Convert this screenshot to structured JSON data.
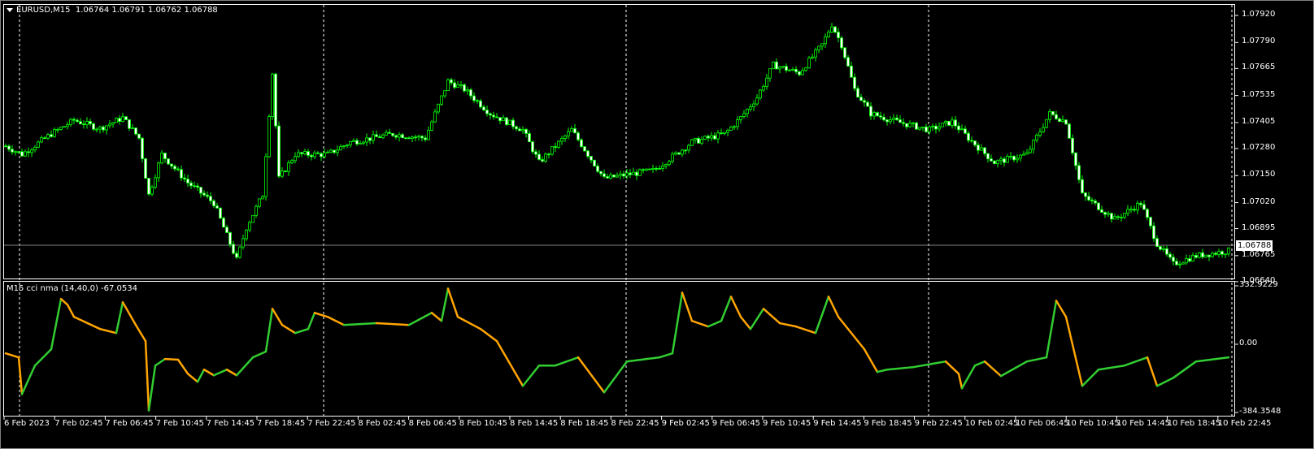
{
  "header": {
    "symbol": "EURUSD,M15",
    "ohlc": "1.06764 1.06791 1.06762 1.06788"
  },
  "indicator": {
    "title": "M15 cci nma (14,40,0) -67.0534"
  },
  "current_price": "1.06788",
  "colors": {
    "bull": "#00ff00",
    "bear_body": "#ffffff",
    "cci_up": "#32cd32",
    "cci_down": "#ffa500",
    "grid": "#ffffff",
    "price_line": "#808080"
  },
  "chart_data": [
    {
      "type": "candlestick",
      "title": "EURUSD,M15",
      "bars": 377,
      "y_ticks": [
        "1.07920",
        "1.07790",
        "1.07665",
        "1.07535",
        "1.07405",
        "1.07280",
        "1.07150",
        "1.07020",
        "1.06895",
        "1.06765",
        "1.06640"
      ],
      "ylim": [
        1.0664,
        1.0792
      ],
      "close_path": [
        [
          0,
          1.07292
        ],
        [
          5,
          1.07252
        ],
        [
          14,
          1.0735
        ],
        [
          21,
          1.07416
        ],
        [
          29,
          1.07377
        ],
        [
          36,
          1.07428
        ],
        [
          41,
          1.0733
        ],
        [
          44,
          1.07057
        ],
        [
          48,
          1.07252
        ],
        [
          56,
          1.07116
        ],
        [
          64,
          1.07018
        ],
        [
          71,
          1.06745
        ],
        [
          74,
          1.06901
        ],
        [
          79,
          1.07057
        ],
        [
          82,
          1.07643
        ],
        [
          84,
          1.07135
        ],
        [
          89,
          1.07252
        ],
        [
          99,
          1.07252
        ],
        [
          106,
          1.07311
        ],
        [
          119,
          1.0735
        ],
        [
          129,
          1.0733
        ],
        [
          136,
          1.07604
        ],
        [
          141,
          1.07565
        ],
        [
          149,
          1.07448
        ],
        [
          159,
          1.0737
        ],
        [
          164,
          1.07213
        ],
        [
          174,
          1.0737
        ],
        [
          184,
          1.07135
        ],
        [
          191,
          1.07155
        ],
        [
          199,
          1.07174
        ],
        [
          206,
          1.07252
        ],
        [
          211,
          1.07311
        ],
        [
          221,
          1.0735
        ],
        [
          226,
          1.07428
        ],
        [
          231,
          1.07526
        ],
        [
          236,
          1.07682
        ],
        [
          244,
          1.07643
        ],
        [
          251,
          1.07779
        ],
        [
          254,
          1.07877
        ],
        [
          257,
          1.07779
        ],
        [
          261,
          1.07565
        ],
        [
          266,
          1.07448
        ],
        [
          274,
          1.07409
        ],
        [
          284,
          1.0737
        ],
        [
          291,
          1.07409
        ],
        [
          296,
          1.0733
        ],
        [
          304,
          1.07213
        ],
        [
          314,
          1.07252
        ],
        [
          321,
          1.07448
        ],
        [
          326,
          1.07409
        ],
        [
          331,
          1.07057
        ],
        [
          341,
          1.0694
        ],
        [
          349,
          1.07018
        ],
        [
          354,
          1.06823
        ],
        [
          359,
          1.06725
        ],
        [
          366,
          1.06764
        ],
        [
          376,
          1.06788
        ]
      ],
      "x_ticks": [
        "6 Feb 2023",
        "7 Feb 02:45",
        "7 Feb 06:45",
        "7 Feb 10:45",
        "7 Feb 14:45",
        "7 Feb 18:45",
        "7 Feb 22:45",
        "8 Feb 02:45",
        "8 Feb 06:45",
        "8 Feb 10:45",
        "8 Feb 14:45",
        "8 Feb 18:45",
        "8 Feb 22:45",
        "9 Feb 02:45",
        "9 Feb 06:45",
        "9 Feb 10:45",
        "9 Feb 14:45",
        "9 Feb 18:45",
        "9 Feb 22:45",
        "10 Feb 02:45",
        "10 Feb 06:45",
        "10 Feb 10:45",
        "10 Feb 14:45",
        "10 Feb 18:45",
        "10 Feb 22:45"
      ]
    },
    {
      "type": "line",
      "title": "M15 cci nma (14,40,0)",
      "y_ticks": [
        "332.9229",
        "0.00",
        "-384.3548"
      ],
      "ylim": [
        -384.3548,
        332.9229
      ],
      "points": [
        [
          0,
          -51
        ],
        [
          4,
          -74
        ],
        [
          5,
          -281
        ],
        [
          9,
          -120
        ],
        [
          14,
          -28
        ],
        [
          17,
          258
        ],
        [
          19,
          225
        ],
        [
          21,
          156
        ],
        [
          29,
          87
        ],
        [
          34,
          64
        ],
        [
          36,
          239
        ],
        [
          40,
          110
        ],
        [
          43,
          18
        ],
        [
          44,
          -373
        ],
        [
          46,
          -120
        ],
        [
          49,
          -83
        ],
        [
          53,
          -87
        ],
        [
          56,
          -166
        ],
        [
          59,
          -212
        ],
        [
          61,
          -143
        ],
        [
          64,
          -175
        ],
        [
          68,
          -143
        ],
        [
          71,
          -175
        ],
        [
          76,
          -74
        ],
        [
          80,
          -41
        ],
        [
          82,
          202
        ],
        [
          85,
          110
        ],
        [
          89,
          64
        ],
        [
          93,
          87
        ],
        [
          95,
          179
        ],
        [
          99,
          156
        ],
        [
          104,
          110
        ],
        [
          114,
          120
        ],
        [
          124,
          110
        ],
        [
          131,
          179
        ],
        [
          134,
          133
        ],
        [
          136,
          317
        ],
        [
          139,
          156
        ],
        [
          146,
          87
        ],
        [
          151,
          18
        ],
        [
          159,
          -235
        ],
        [
          164,
          -120
        ],
        [
          169,
          -120
        ],
        [
          176,
          -74
        ],
        [
          184,
          -271
        ],
        [
          191,
          -97
        ],
        [
          201,
          -74
        ],
        [
          205,
          -51
        ],
        [
          208,
          294
        ],
        [
          211,
          133
        ],
        [
          216,
          101
        ],
        [
          220,
          133
        ],
        [
          223,
          271
        ],
        [
          226,
          156
        ],
        [
          229,
          87
        ],
        [
          233,
          202
        ],
        [
          238,
          120
        ],
        [
          243,
          101
        ],
        [
          249,
          64
        ],
        [
          253,
          271
        ],
        [
          256,
          156
        ],
        [
          264,
          -28
        ],
        [
          268,
          -156
        ],
        [
          271,
          -143
        ],
        [
          279,
          -129
        ],
        [
          289,
          -97
        ],
        [
          293,
          -166
        ],
        [
          294,
          -248
        ],
        [
          298,
          -120
        ],
        [
          301,
          -97
        ],
        [
          306,
          -179
        ],
        [
          314,
          -97
        ],
        [
          320,
          -74
        ],
        [
          323,
          248
        ],
        [
          326,
          156
        ],
        [
          331,
          -235
        ],
        [
          336,
          -143
        ],
        [
          344,
          -120
        ],
        [
          351,
          -74
        ],
        [
          354,
          -235
        ],
        [
          359,
          -189
        ],
        [
          366,
          -97
        ],
        [
          376,
          -74
        ]
      ]
    }
  ]
}
